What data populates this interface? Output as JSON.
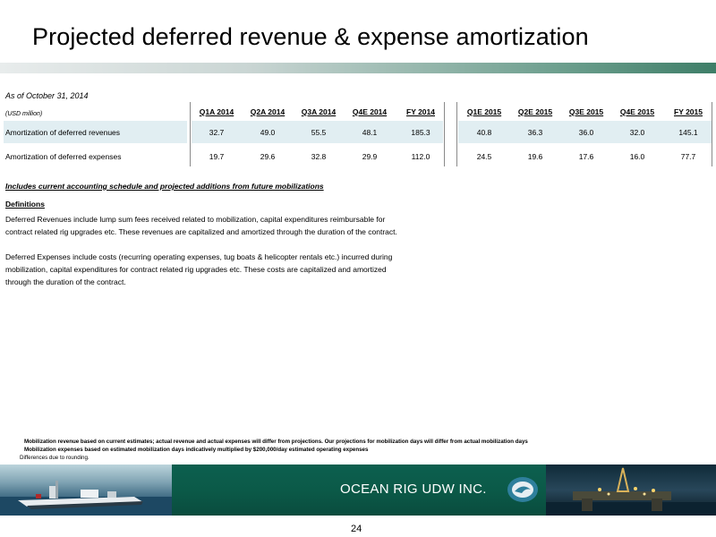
{
  "title": "Projected deferred revenue & expense amortization",
  "as_of": "As of October 31, 2014",
  "units": "(USD million)",
  "table": {
    "columns": [
      "Q1A 2014",
      "Q2A 2014",
      "Q3A 2014",
      "Q4E 2014",
      "FY 2014",
      "Q1E 2015",
      "Q2E 2015",
      "Q3E 2015",
      "Q4E 2015",
      "FY 2015"
    ],
    "rows": [
      {
        "label": "Amortization of deferred revenues",
        "values": [
          "32.7",
          "49.0",
          "55.5",
          "48.1",
          "185.3",
          "40.8",
          "36.3",
          "36.0",
          "32.0",
          "145.1"
        ]
      },
      {
        "label": "Amortization of deferred expenses",
        "values": [
          "19.7",
          "29.6",
          "32.8",
          "29.9",
          "112.0",
          "24.5",
          "19.6",
          "17.6",
          "16.0",
          "77.7"
        ]
      }
    ]
  },
  "schedule_note": "Includes current accounting schedule and projected additions from future mobilizations",
  "definitions_heading": "Definitions",
  "definitions": {
    "revenues_line1": "Deferred Revenues include lump sum fees received related to mobilization, capital expenditures reimbursable for",
    "revenues_line2": "contract related rig upgrades etc.  These revenues are capitalized and amortized through the duration of the contract.",
    "expenses_line1": "Deferred Expenses include costs (recurring operating expenses, tug boats & helicopter rentals etc.)  incurred during",
    "expenses_line2": "mobilization, capital expenditures for contract related rig upgrades etc.  These costs are capitalized and amortized",
    "expenses_line3": "through the duration of the contract."
  },
  "footnotes": {
    "line1": "Mobilization revenue based on current estimates; actual revenue and actual expenses will differ from projections. Our projections for mobilization days will differ from actual mobilization days",
    "line2": "Mobilization expenses based on estimated  mobilization days indicatively  multiplied by $200,000/day estimated operating expenses",
    "line3": "Differences due to rounding."
  },
  "company_name": "OCEAN RIG UDW INC.",
  "page_number": "24",
  "colors": {
    "row_shade": "#e1eef2",
    "banner_green": "#0b5a48",
    "title_bar_end": "#3e7e68"
  }
}
